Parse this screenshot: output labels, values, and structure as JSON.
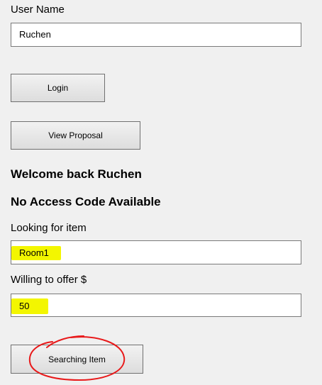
{
  "form": {
    "username_label": "User Name",
    "username_value": "Ruchen",
    "login_label": "Login",
    "view_proposal_label": "View Proposal",
    "welcome_text": "Welcome back Ruchen",
    "access_code_text": "No Access Code Available",
    "looking_label": "Looking for item",
    "looking_value": "Room1",
    "offer_label": "Willing to offer $",
    "offer_value": "50",
    "search_button_label": "Searching Item"
  },
  "colors": {
    "background": "#f0f0f0",
    "highlight": "#f3f600",
    "annotation": "#e8191a"
  }
}
